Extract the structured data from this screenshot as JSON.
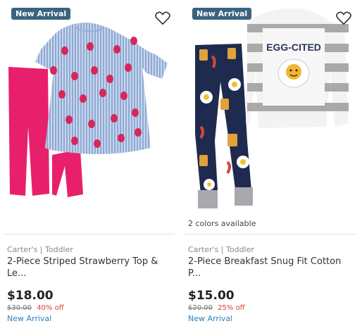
{
  "products": [
    {
      "badge": "New Arrival",
      "colors_available": "",
      "brand": "Carter's | Toddler",
      "name_line1": "2-Piece Striped Strawberry Top &",
      "name_line2": "Le...",
      "price": "$18.00",
      "original_price": "$30.00",
      "discount": "40% off",
      "status": "New Arrival",
      "image_alt": "striped strawberry top and pink leggings"
    },
    {
      "badge": "New Arrival",
      "colors_available": "2 colors available",
      "brand": "Carter's | Toddler",
      "name_line1": "2-Piece Breakfast Snug Fit Cotton",
      "name_line2": "P...",
      "price": "$15.00",
      "original_price": "$20.00",
      "discount": "25% off",
      "status": "New Arrival",
      "image_alt": "breakfast pajama set, EGG-CITED striped top",
      "shirt_text": "EGG-CITED"
    }
  ],
  "colors": {
    "badge_bg": "#3a6380",
    "discount": "#d2413b",
    "status_link": "#2f7fb7",
    "legging_pink": "#e8206b",
    "navy_pants": "#1f2a4f"
  },
  "icons": [
    "heart-icon"
  ]
}
